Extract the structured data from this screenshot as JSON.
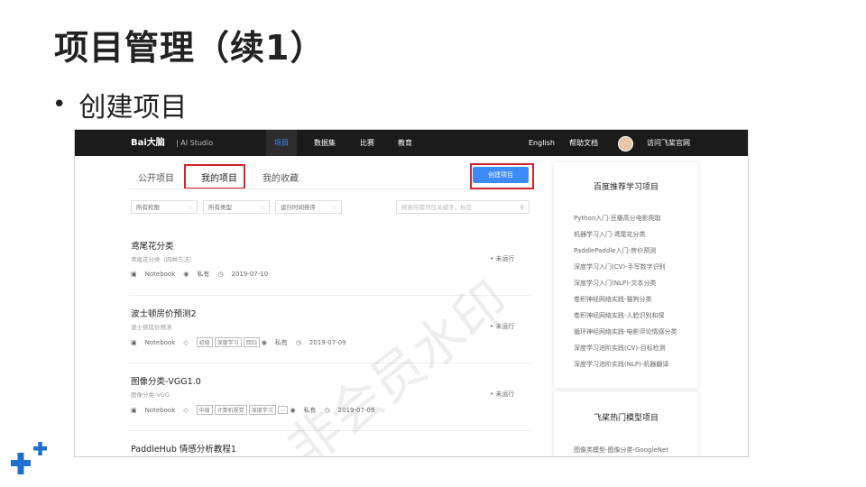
{
  "slide": {
    "title": "项目管理（续1）",
    "bullet": "创建项目"
  },
  "topbar": {
    "logo": "Bai大脑",
    "product": "| AI Studio",
    "nav": [
      "项目",
      "数据集",
      "比赛",
      "教育"
    ],
    "right": [
      "English",
      "帮助文档",
      "访问飞桨官网"
    ]
  },
  "tabs": [
    "公开项目",
    "我的项目",
    "我的收藏"
  ],
  "create_button": "创建项目",
  "filters": [
    "所有权限",
    "所有类型",
    "运行时间排序"
  ],
  "search_placeholder": "搜索所需项目关键字、标签",
  "projects": [
    {
      "name": "鸢尾花分类",
      "desc": "鸢尾花分类（四种方法）",
      "platform": "Notebook",
      "privacy": "私有",
      "date": "2019-07-10",
      "status": "• 未运行"
    },
    {
      "name": "波士顿房价预测2",
      "desc": "波士顿房价预测",
      "platform": "Notebook",
      "tags": [
        "初级",
        "深度学习",
        "回归"
      ],
      "privacy": "私有",
      "date": "2019-07-09",
      "status": "• 未运行"
    },
    {
      "name": "图像分类-VGG1.0",
      "desc": "图像分类-VGG",
      "platform": "Notebook",
      "tags": [
        "中级",
        "计算机视觉",
        "深度学习",
        "..."
      ],
      "privacy": "私有",
      "date": "2019-07-09",
      "status": "• 未运行"
    },
    {
      "name": "PaddleHub 情感分析教程1"
    }
  ],
  "sidebar": {
    "rec_title": "百度推荐学习项目",
    "rec_items": [
      "Python入门-豆瓣高分电影爬取",
      "机器学习入门-鸢尾花分类",
      "PaddlePaddle入门-房价预测",
      "深度学习入门(CV)-手写数字识别",
      "深度学习入门(NLP)-文本分类",
      "卷积神经网络实践-猫狗分类",
      "卷积神经网络实践-人脸识别和探",
      "循环神经网络实践-电影评论情感分类",
      "深度学习进阶实践(CV)-目标检测",
      "深度学习进阶实践(NLP)-机器翻译"
    ],
    "hot_title": "飞桨热门模型项目",
    "hot_items": [
      "图像类模型-图像分类-GoogleNet"
    ]
  },
  "watermark": "非会员水印",
  "colors": {
    "accent": "#3d8bf8",
    "highlight_box": "#d0242b",
    "topbar": "#1b1b1b"
  }
}
